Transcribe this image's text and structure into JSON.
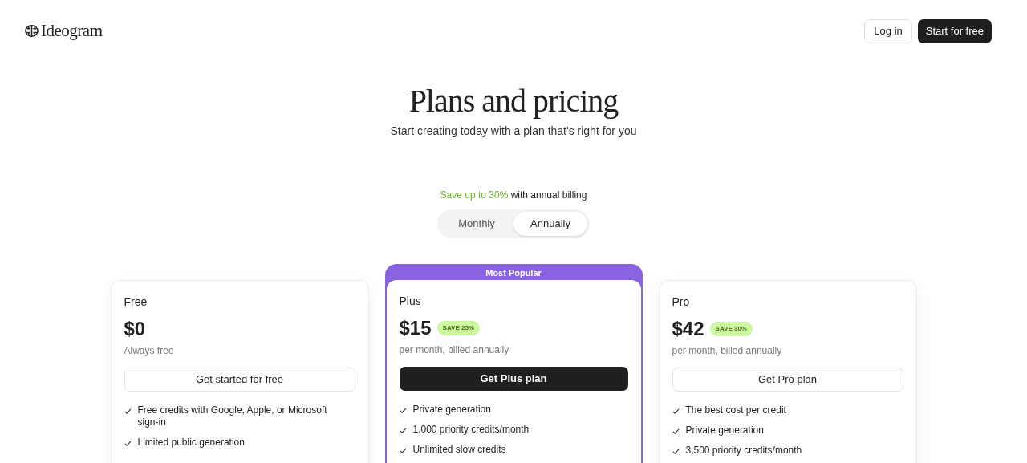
{
  "header": {
    "logo": "Ideogram",
    "buttons": [
      {
        "label": "Log in",
        "kind": "outline"
      },
      {
        "label": "Start for free",
        "kind": "solid"
      }
    ]
  },
  "title": "Plans and pricing",
  "subtitle": "Start creating today with a plan that's right for you",
  "billing_note": {
    "highlight": "Save up to 30%",
    "rest": "with annual billing"
  },
  "billing_toggle": [
    {
      "label": "Monthly",
      "selected": false
    },
    {
      "label": "Annually",
      "selected": true
    }
  ],
  "plans": [
    {
      "name": "Free",
      "price": "$0",
      "period": "Always free",
      "button": "Get started for free",
      "featured": false,
      "features": [
        "Free credits with Google, Apple, or Microsoft sign-in",
        "Limited public generation"
      ]
    },
    {
      "name": "Plus",
      "banner": "Most Popular",
      "price": "$15",
      "badge": "SAVE 25%",
      "period": "per month, billed annually",
      "button": "Get Plus plan",
      "featured": true,
      "features": [
        "Private generation",
        "1,000 priority credits/month",
        "Unlimited slow credits"
      ]
    },
    {
      "name": "Pro",
      "price": "$42",
      "badge": "SAVE 30%",
      "period": "per month, billed annually",
      "button": "Get Pro plan",
      "featured": false,
      "features": [
        "The best cost per credit",
        "Private generation",
        "3,500 priority credits/month"
      ]
    }
  ]
}
